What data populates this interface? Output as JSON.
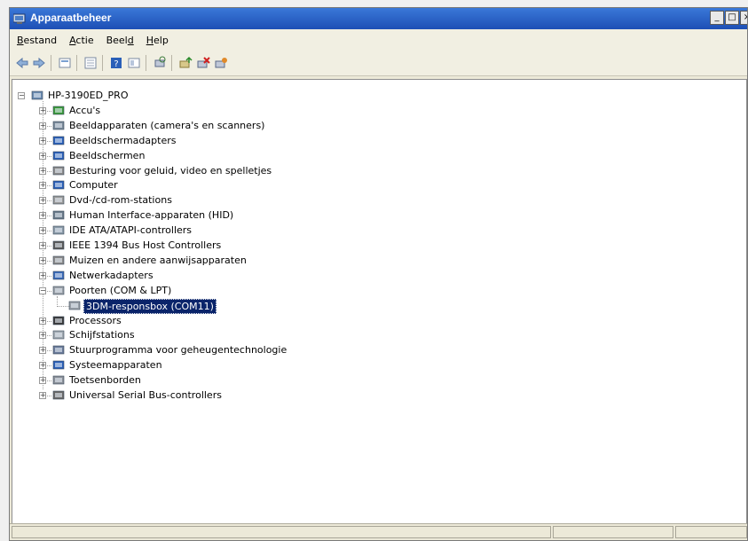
{
  "window": {
    "title": "Apparaatbeheer"
  },
  "menu": [
    {
      "label": "Bestand",
      "underline_index": 0
    },
    {
      "label": "Actie",
      "underline_index": 0
    },
    {
      "label": "Beeld",
      "underline_index": 4
    },
    {
      "label": "Help",
      "underline_index": 0
    }
  ],
  "toolbar": {
    "buttons": [
      "back-icon",
      "forward-icon",
      "properties-icon",
      "list-icon",
      "help-icon",
      "view-icon",
      "scan-hardware-icon",
      "update-driver-icon",
      "uninstall-icon",
      "disable-icon"
    ]
  },
  "tree": {
    "root": "HP-3190ED_PRO",
    "items": [
      {
        "label": "Accu's",
        "icon": "battery-icon"
      },
      {
        "label": "Beeldapparaten (camera's en scanners)",
        "icon": "camera-icon"
      },
      {
        "label": "Beeldschermadapters",
        "icon": "display-adapter-icon"
      },
      {
        "label": "Beeldschermen",
        "icon": "monitor-icon"
      },
      {
        "label": "Besturing voor geluid, video en spelletjes",
        "icon": "sound-icon"
      },
      {
        "label": "Computer",
        "icon": "computer-icon"
      },
      {
        "label": "Dvd-/cd-rom-stations",
        "icon": "dvd-icon"
      },
      {
        "label": "Human Interface-apparaten (HID)",
        "icon": "hid-icon"
      },
      {
        "label": "IDE ATA/ATAPI-controllers",
        "icon": "ide-icon"
      },
      {
        "label": "IEEE 1394 Bus Host Controllers",
        "icon": "firewire-icon"
      },
      {
        "label": "Muizen en andere aanwijsapparaten",
        "icon": "mouse-icon"
      },
      {
        "label": "Netwerkadapters",
        "icon": "network-icon"
      },
      {
        "label": "Poorten (COM & LPT)",
        "icon": "port-icon",
        "expanded": true
      },
      {
        "label": "3DM-responsbox (COM11)",
        "icon": "port-device-icon",
        "child": true,
        "selected": true
      },
      {
        "label": "Processors",
        "icon": "processor-icon"
      },
      {
        "label": "Schijfstations",
        "icon": "disk-icon"
      },
      {
        "label": "Stuurprogramma voor geheugentechnologie",
        "icon": "memory-icon"
      },
      {
        "label": "Systeemapparaten",
        "icon": "system-icon"
      },
      {
        "label": "Toetsenborden",
        "icon": "keyboard-icon"
      },
      {
        "label": "Universal Serial Bus-controllers",
        "icon": "usb-icon"
      }
    ]
  },
  "colors": {
    "title_bar": "#1d4fb5",
    "selection": "#0a246a"
  }
}
